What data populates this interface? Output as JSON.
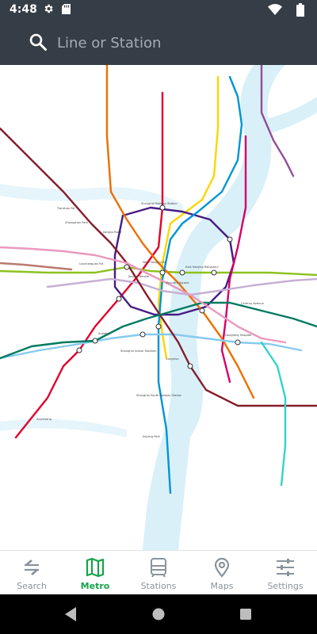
{
  "status_bar": {
    "time": "4:48",
    "icons": [
      "gear-icon",
      "sd-card-icon",
      "wifi-icon",
      "battery-icon"
    ]
  },
  "search": {
    "placeholder": "Line or Station",
    "icon": "search-icon"
  },
  "map": {
    "labels": {
      "station_a": "Tianshan Rd",
      "station_b": "Loushanguan Rd",
      "station_c": "Zhongshan Park",
      "station_d": "Jiangsu Road",
      "station_e": "Jing'an Temple",
      "station_f": "West Nanjing Rd",
      "station_g": "People's Square",
      "station_h": "East Nanjing Rd",
      "station_i": "Lujiazui",
      "station_j": "Century Avenue",
      "station_k": "Shanghai Railway Station",
      "station_l": "Xujiahui",
      "station_m": "Shanghai Indoor Stadium",
      "station_n": "Longhua",
      "station_o": "Shanghai South Railway Station",
      "station_p": "Jinjiang Park",
      "station_q": "Xinzhuang",
      "station_r": "Dongfang Hospital"
    }
  },
  "bottom_nav": {
    "items": [
      {
        "label": "Search",
        "icon": "search-route-icon",
        "active": false
      },
      {
        "label": "Metro",
        "icon": "map-icon",
        "active": true
      },
      {
        "label": "Stations",
        "icon": "train-icon",
        "active": false
      },
      {
        "label": "Maps",
        "icon": "location-pin-icon",
        "active": false
      },
      {
        "label": "Settings",
        "icon": "settings-sliders-icon",
        "active": false
      }
    ]
  },
  "colors": {
    "app_bar": "#353d46",
    "active": "#17a34a",
    "inactive": "#8a939c",
    "line1": "#e3002b",
    "line2": "#8cc220",
    "line3": "#fcd600",
    "line4": "#461d84",
    "line5": "#944d9a",
    "line6": "#d40068",
    "line7": "#ed6f00",
    "line8": "#0094d8",
    "line9": "#87caed",
    "line10": "#c6afd4",
    "line11": "#871c2b",
    "line12": "#007a60",
    "line13": "#e999c0",
    "line16": "#32d4cb",
    "line17": "#bc796f",
    "water": "#d9f0f8"
  }
}
